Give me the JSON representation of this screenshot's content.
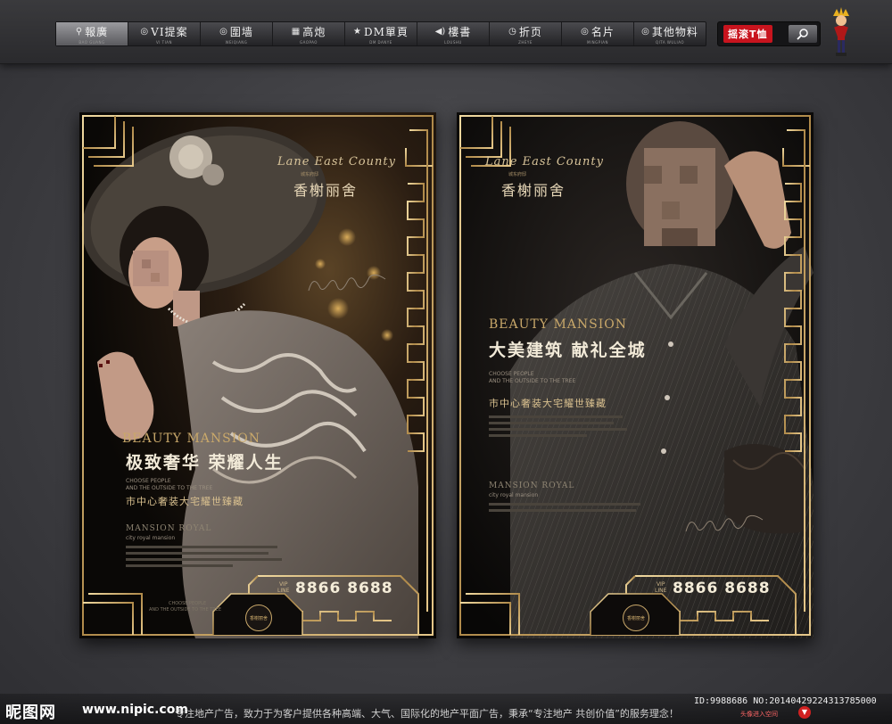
{
  "nav": {
    "items": [
      {
        "icon": "⚲",
        "label": "報廣",
        "sub": "BAO GUANG",
        "active": true
      },
      {
        "icon": "◎",
        "label": "VI提案",
        "sub": "VI TIAN"
      },
      {
        "icon": "◎",
        "label": "圍墙",
        "sub": "WEIQIANG"
      },
      {
        "icon": "▦",
        "label": "高炮",
        "sub": "GAOPAO"
      },
      {
        "icon": "★",
        "label": "DM單頁",
        "sub": "DM DANYE"
      },
      {
        "icon": "◀)",
        "label": "樓書",
        "sub": "LOUSHU"
      },
      {
        "icon": "◷",
        "label": "折页",
        "sub": "ZHEYE"
      },
      {
        "icon": "◎",
        "label": "名片",
        "sub": "MINGPIAN"
      },
      {
        "icon": "◎",
        "label": "其他物料",
        "sub": "QITA WULIAO"
      }
    ]
  },
  "search": {
    "brand": "摇滚T恤"
  },
  "poster_left": {
    "brand_en": "Lane East County",
    "brand_small": "城东府邸",
    "brand_cn": "香榭丽舍",
    "beauty": "BEAUTY MANSION",
    "headline": "极致奢华 荣耀人生",
    "tagline_en_1": "CHOOSE PEOPLE",
    "tagline_en_2": "AND THE OUTSIDE TO THE TREE",
    "sub_cn": "市中心奢装大宅耀世臻藏",
    "royal": "MANSION ROYAL",
    "royal_sub": "city royal mansion",
    "vip_1": "VIP",
    "vip_2": "LINE",
    "phone": "8866 8688",
    "seal": "香榭丽舍",
    "footer_1": "CHOOSE PEOPLE",
    "footer_2": "AND THE OUTSIDE TO THE TREE"
  },
  "poster_right": {
    "brand_en": "Lane East County",
    "brand_small": "城东府邸",
    "brand_cn": "香榭丽舍",
    "beauty": "BEAUTY MANSION",
    "headline": "大美建筑 献礼全城",
    "tagline_en_1": "CHOOSE PEOPLE",
    "tagline_en_2": "AND THE OUTSIDE TO THE TREE",
    "sub_cn": "市中心奢装大宅耀世臻藏",
    "royal": "MANSION ROYAL",
    "royal_sub": "city royal mansion",
    "vip_1": "VIP",
    "vip_2": "LINE",
    "phone": "8866 8688",
    "seal": "香榭丽舍"
  },
  "watermark": {
    "logo": "昵图网",
    "url": "www.nipic.com",
    "slogan": "专注地产广告，致力于为客户提供各种高端、大气、国际化的地产平面广告，秉承“专注地产 共创价值”的服务理念！",
    "id": "ID:9988686 NO:20140429224313785000",
    "badge": "头像进入空间"
  },
  "colors": {
    "gold": "#c9a86a",
    "dark": "#0d0b0a",
    "accent_red": "#c8141e"
  }
}
